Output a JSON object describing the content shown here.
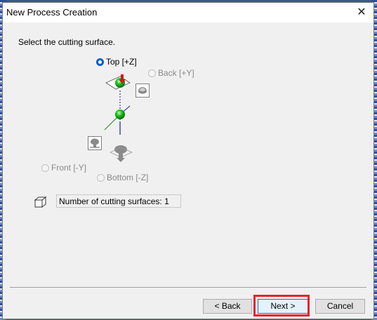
{
  "window": {
    "title": "New Process Creation"
  },
  "prompt": "Select the cutting surface.",
  "options": {
    "top": "Top [+Z]",
    "back": "Back [+Y]",
    "front": "Front [-Y]",
    "bottom": "Bottom [-Z]"
  },
  "selected_option": "Top [+Z]",
  "surface_count": "Number of cutting surfaces: 1",
  "buttons": {
    "back": "< Back",
    "next": "Next >",
    "cancel": "Cancel"
  },
  "colors": {
    "accent": "#0060c0",
    "highlight": "#e8212a",
    "sphere": "#1fc01f"
  },
  "icons": [
    "close-icon",
    "cube-icon",
    "back-view-icon",
    "front-view-icon",
    "top-view-icon",
    "bottom-view-icon",
    "surface-arrow-icon"
  ]
}
